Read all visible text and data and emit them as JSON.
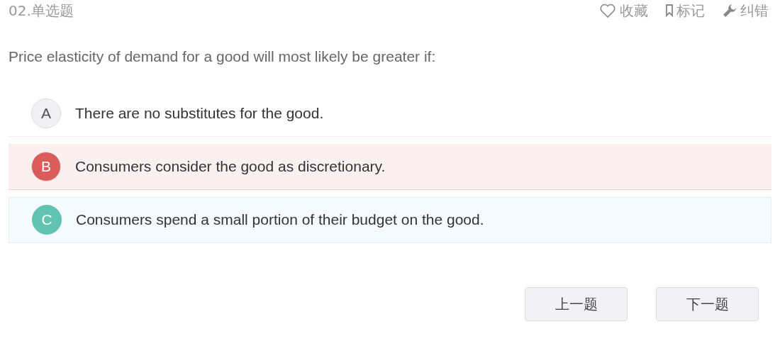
{
  "header": {
    "number": "02.单选题",
    "actions": [
      {
        "kind": "favorite",
        "label": "收藏"
      },
      {
        "kind": "bookmark",
        "label": "标记"
      },
      {
        "kind": "report",
        "label": "纠错"
      }
    ]
  },
  "question": "Price elasticity of demand for a good will most likely be greater if:",
  "options": [
    {
      "letter": "A",
      "text": "There are no substitutes for the good.",
      "selected": false,
      "correct": false
    },
    {
      "letter": "B",
      "text": "Consumers consider the good as discretionary.",
      "selected": true,
      "correct": false
    },
    {
      "letter": "C",
      "text": "Consumers spend a small portion of their budget on the good.",
      "selected": false,
      "correct": true
    }
  ],
  "buttons": [
    "上一题",
    "下一题"
  ]
}
